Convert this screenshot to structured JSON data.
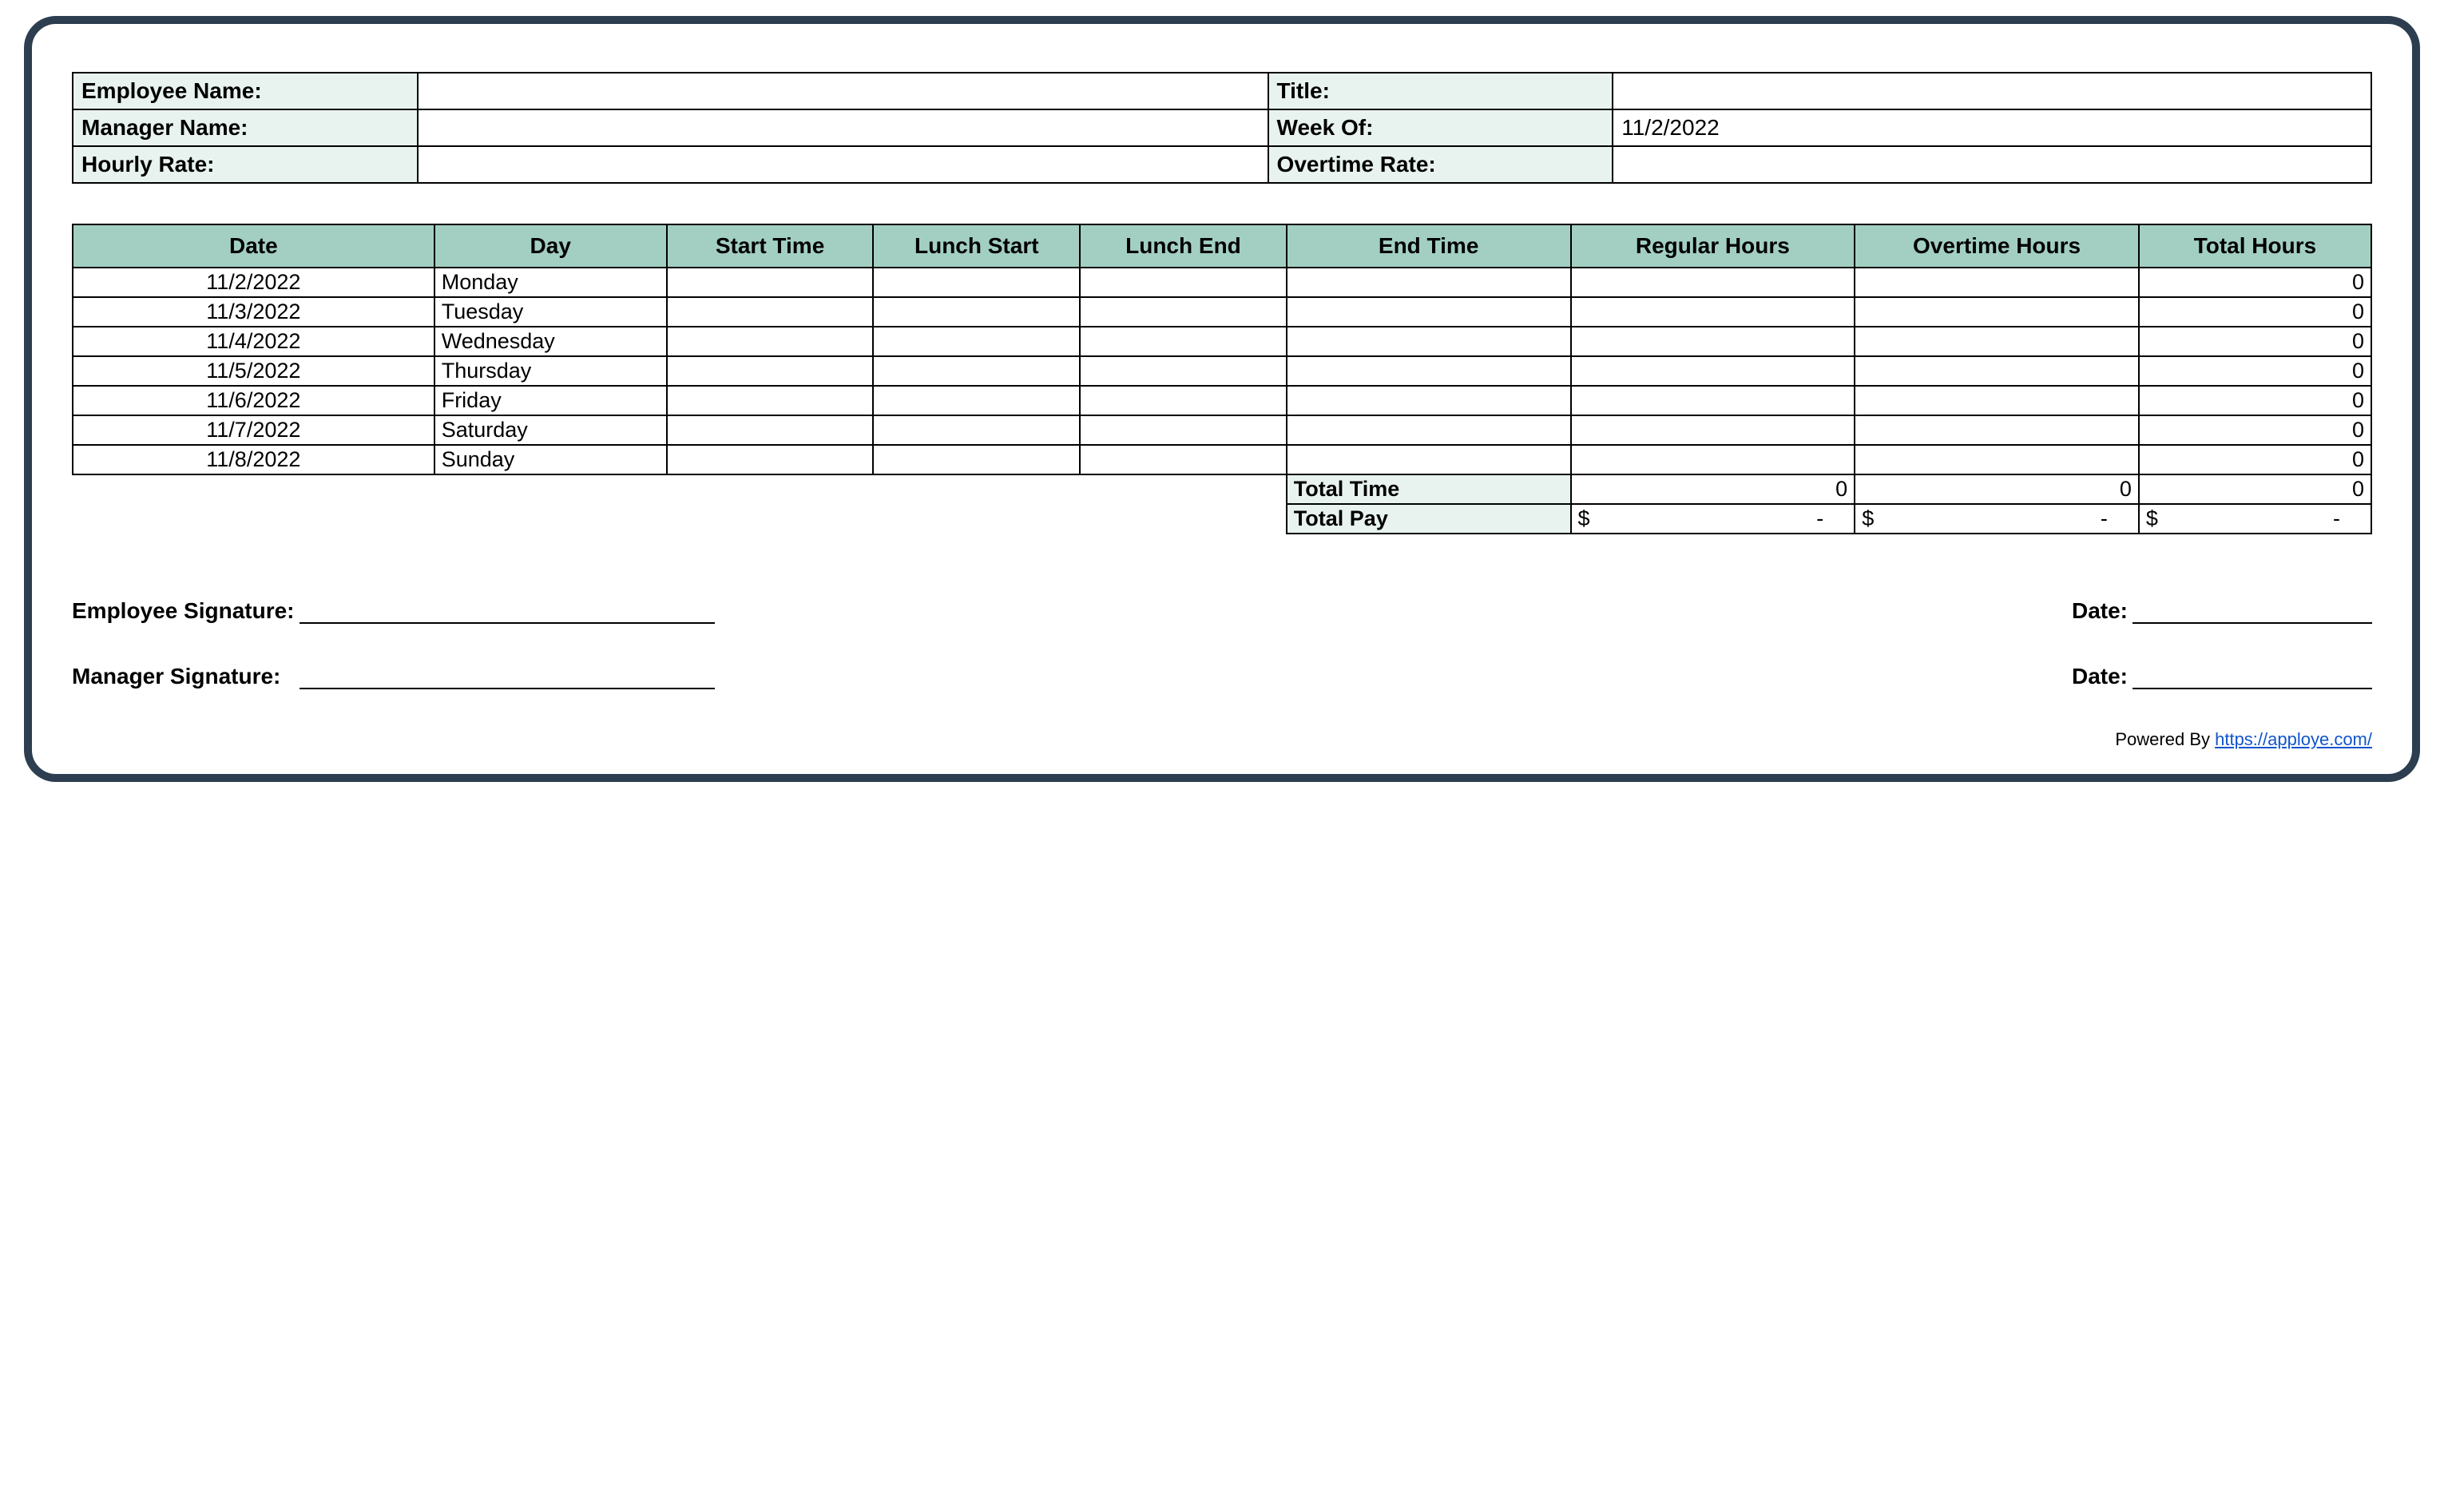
{
  "info": {
    "employee_name_label": "Employee Name:",
    "employee_name_value": "",
    "title_label": "Title:",
    "title_value": "",
    "manager_name_label": "Manager Name:",
    "manager_name_value": "",
    "week_of_label": "Week Of:",
    "week_of_value": "11/2/2022",
    "hourly_rate_label": "Hourly Rate:",
    "hourly_rate_value": "",
    "overtime_rate_label": "Overtime Rate:",
    "overtime_rate_value": ""
  },
  "columns": {
    "date": "Date",
    "day": "Day",
    "start_time": "Start Time",
    "lunch_start": "Lunch Start",
    "lunch_end": "Lunch End",
    "end_time": "End Time",
    "regular_hours": "Regular Hours",
    "overtime_hours": "Overtime Hours",
    "total_hours": "Total Hours"
  },
  "rows": [
    {
      "date": "11/2/2022",
      "day": "Monday",
      "start_time": "",
      "lunch_start": "",
      "lunch_end": "",
      "end_time": "",
      "regular_hours": "",
      "overtime_hours": "",
      "total_hours": "0"
    },
    {
      "date": "11/3/2022",
      "day": "Tuesday",
      "start_time": "",
      "lunch_start": "",
      "lunch_end": "",
      "end_time": "",
      "regular_hours": "",
      "overtime_hours": "",
      "total_hours": "0"
    },
    {
      "date": "11/4/2022",
      "day": "Wednesday",
      "start_time": "",
      "lunch_start": "",
      "lunch_end": "",
      "end_time": "",
      "regular_hours": "",
      "overtime_hours": "",
      "total_hours": "0"
    },
    {
      "date": "11/5/2022",
      "day": "Thursday",
      "start_time": "",
      "lunch_start": "",
      "lunch_end": "",
      "end_time": "",
      "regular_hours": "",
      "overtime_hours": "",
      "total_hours": "0"
    },
    {
      "date": "11/6/2022",
      "day": "Friday",
      "start_time": "",
      "lunch_start": "",
      "lunch_end": "",
      "end_time": "",
      "regular_hours": "",
      "overtime_hours": "",
      "total_hours": "0"
    },
    {
      "date": "11/7/2022",
      "day": "Saturday",
      "start_time": "",
      "lunch_start": "",
      "lunch_end": "",
      "end_time": "",
      "regular_hours": "",
      "overtime_hours": "",
      "total_hours": "0"
    },
    {
      "date": "11/8/2022",
      "day": "Sunday",
      "start_time": "",
      "lunch_start": "",
      "lunch_end": "",
      "end_time": "",
      "regular_hours": "",
      "overtime_hours": "",
      "total_hours": "0"
    }
  ],
  "summary": {
    "total_time_label": "Total Time",
    "total_time_regular": "0",
    "total_time_overtime": "0",
    "total_time_total": "0",
    "total_pay_label": "Total Pay",
    "currency_symbol": "$",
    "pay_dash": "-"
  },
  "signatures": {
    "employee_label": "Employee Signature:",
    "manager_label": "Manager Signature:",
    "date_label": "Date:"
  },
  "footer": {
    "prefix": "Powered By ",
    "link_text": "https://apploye.com/",
    "link_href": "https://apploye.com/"
  }
}
